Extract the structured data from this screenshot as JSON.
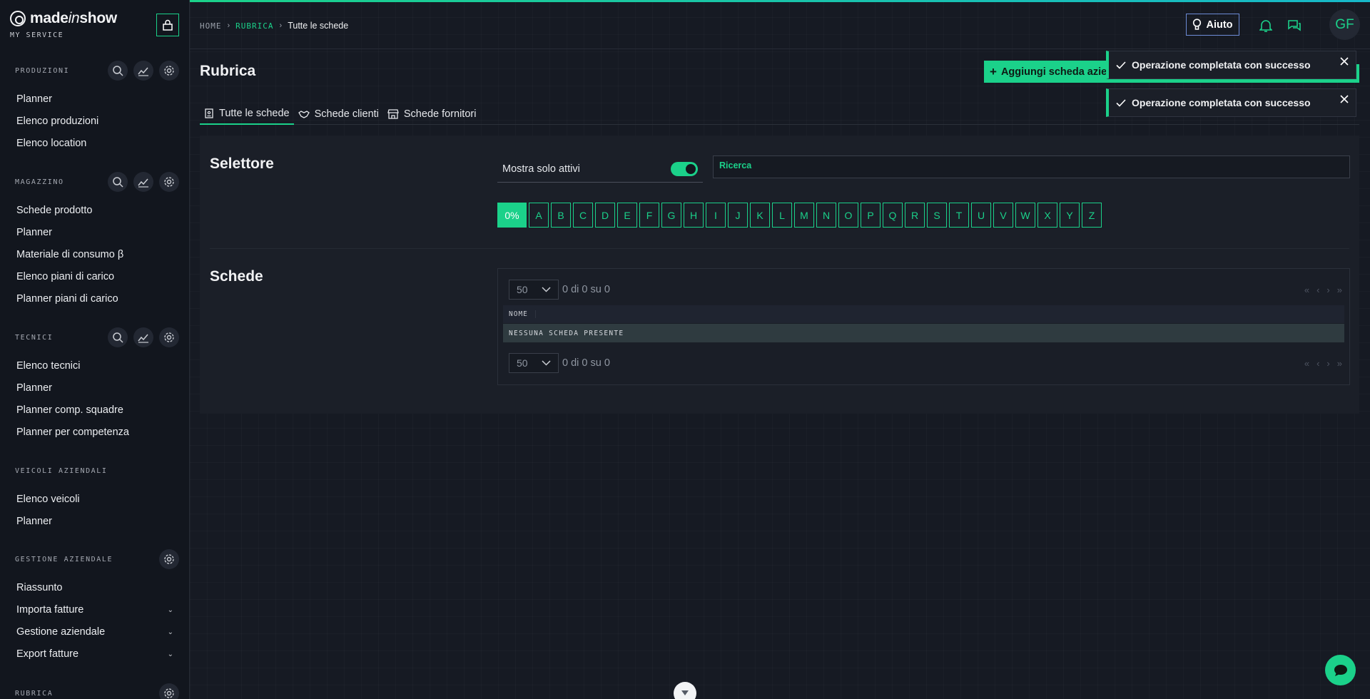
{
  "brand": {
    "name_pre": "made",
    "name_mid": "in",
    "name_post": "show",
    "subtitle": "MY SERVICE"
  },
  "sidebar": {
    "sections": [
      {
        "title": "PRODUZIONI",
        "items": [
          "Planner",
          "Elenco produzioni",
          "Elenco location"
        ]
      },
      {
        "title": "MAGAZZINO",
        "items": [
          "Schede prodotto",
          "Planner",
          "Materiale di consumo β",
          "Elenco piani di carico",
          "Planner piani di carico"
        ]
      },
      {
        "title": "TECNICI",
        "items": [
          "Elenco tecnici",
          "Planner",
          "Planner comp. squadre",
          "Planner per competenza"
        ]
      },
      {
        "title": "VEICOLI AZIENDALI",
        "items": [
          "Elenco veicoli",
          "Planner"
        ]
      },
      {
        "title": "GESTIONE AZIENDALE",
        "items": [
          "Riassunto",
          "Importa fatture",
          "Gestione aziendale",
          "Export fatture"
        ]
      },
      {
        "title": "RUBRICA",
        "items": []
      }
    ]
  },
  "breadcrumb": {
    "home": "HOME",
    "section": "RUBRICA",
    "current": "Tutte le schede"
  },
  "header": {
    "help_label": "Aiuto",
    "avatar_initials": "GF"
  },
  "page": {
    "title": "Rubrica",
    "add_button": "Aggiungi scheda azie",
    "tabs": [
      "Tutte le schede",
      "Schede clienti",
      "Schede fornitori"
    ]
  },
  "selector": {
    "title": "Selettore",
    "toggle_label": "Mostra solo attivi",
    "toggle_on": true,
    "search_placeholder": "Ricerca",
    "letters": [
      "0%",
      "A",
      "B",
      "C",
      "D",
      "E",
      "F",
      "G",
      "H",
      "I",
      "J",
      "K",
      "L",
      "M",
      "N",
      "O",
      "P",
      "Q",
      "R",
      "S",
      "T",
      "U",
      "V",
      "W",
      "X",
      "Y",
      "Z"
    ]
  },
  "schede": {
    "title": "Schede",
    "page_size": "50",
    "count_text": "0 di 0 su 0",
    "column_name": "NOME",
    "empty_text": "NESSUNA SCHEDA PRESENTE"
  },
  "toasts": [
    "Operazione completata con successo",
    "Operazione completata con successo"
  ],
  "colors": {
    "accent": "#1bd18a",
    "background": "#151922",
    "sidebar": "#12161e",
    "help_border": "#6c8bd6"
  }
}
